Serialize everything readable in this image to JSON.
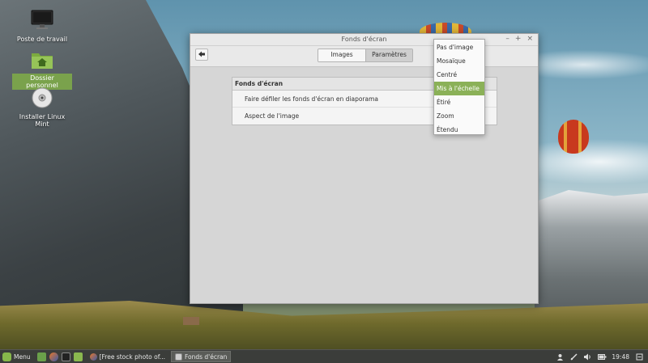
{
  "desktop": {
    "icons": [
      {
        "label": "Poste de travail",
        "icon": "computer-icon"
      },
      {
        "label": "Dossier personnel",
        "icon": "home-folder-icon"
      },
      {
        "label": "Installer Linux Mint",
        "icon": "disc-icon"
      }
    ]
  },
  "window": {
    "title": "Fonds d'écran",
    "controls": {
      "minimize": "–",
      "maximize": "+",
      "close": "×"
    },
    "back_icon": "back-arrow-icon",
    "tabs": [
      {
        "label": "Images",
        "active": false
      },
      {
        "label": "Paramètres",
        "active": true
      }
    ],
    "section": {
      "header": "Fonds d'écran",
      "rows": [
        "Faire défiler les fonds d'écran en diaporama",
        "Aspect de l'image"
      ]
    }
  },
  "dropdown": {
    "options": [
      "Pas d'image",
      "Mosaïque",
      "Centré",
      "Mis à l'échelle",
      "Étiré",
      "Zoom",
      "Étendu"
    ],
    "selected_index": 3
  },
  "taskbar": {
    "menu_label": "Menu",
    "launchers": [
      "show-desktop-icon",
      "firefox-icon",
      "terminal-icon",
      "files-icon"
    ],
    "tasks": [
      {
        "label": "[Free stock photo of...",
        "active": false
      },
      {
        "label": "Fonds d'écran",
        "active": true
      }
    ],
    "tray": {
      "clock": "19:48"
    }
  },
  "colors": {
    "accent": "#8bb158",
    "selection": "#7aa24c",
    "panel": "#3b3d3a"
  }
}
